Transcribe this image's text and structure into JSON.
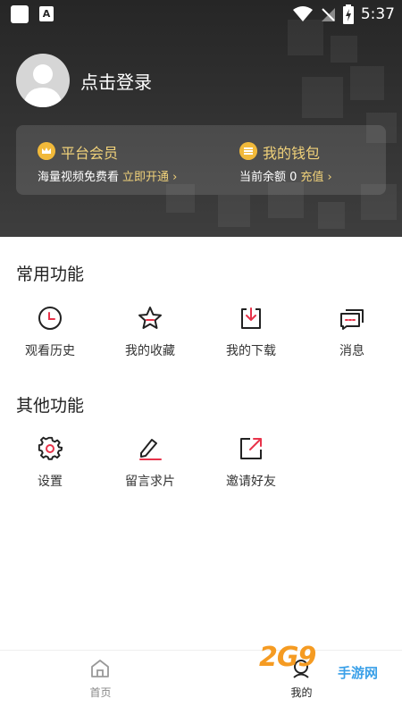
{
  "status_bar": {
    "time": "5:37"
  },
  "profile": {
    "login_text": "点击登录"
  },
  "vip_card": {
    "title": "平台会员",
    "subtitle": "海量视频免费看",
    "link": "立即开通 ›"
  },
  "wallet_card": {
    "title": "我的钱包",
    "subtitle": "当前余额 0",
    "link": "充值 ›"
  },
  "common_functions": {
    "title": "常用功能",
    "items": [
      {
        "label": "观看历史",
        "icon": "clock-icon"
      },
      {
        "label": "我的收藏",
        "icon": "star-icon"
      },
      {
        "label": "我的下载",
        "icon": "download-icon"
      },
      {
        "label": "消息",
        "icon": "message-icon"
      }
    ]
  },
  "other_functions": {
    "title": "其他功能",
    "items": [
      {
        "label": "设置",
        "icon": "gear-icon"
      },
      {
        "label": "留言求片",
        "icon": "edit-icon"
      },
      {
        "label": "邀请好友",
        "icon": "share-icon"
      }
    ]
  },
  "bottom_nav": {
    "items": [
      {
        "label": "首页",
        "icon": "home-icon",
        "active": false
      },
      {
        "label": "我的",
        "icon": "profile-icon",
        "active": true
      }
    ]
  },
  "watermark": {
    "text": "2G9",
    "sub": "手游网"
  },
  "colors": {
    "accent": "#e8334a",
    "gold": "#f1d27a",
    "header_bg": "#2b2b2b"
  }
}
